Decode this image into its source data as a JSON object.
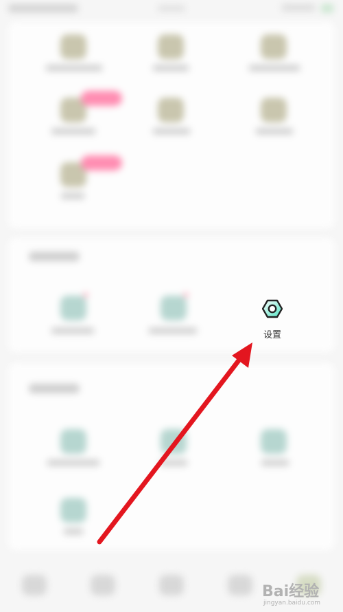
{
  "settings": {
    "label": "设置",
    "icon": "hexagon-gear-icon"
  },
  "watermark": {
    "logo": "Bai经验",
    "sub": "jingyan.baidu.com"
  },
  "colors": {
    "accent": "#50e3c2",
    "arrow": "#e3161f"
  }
}
